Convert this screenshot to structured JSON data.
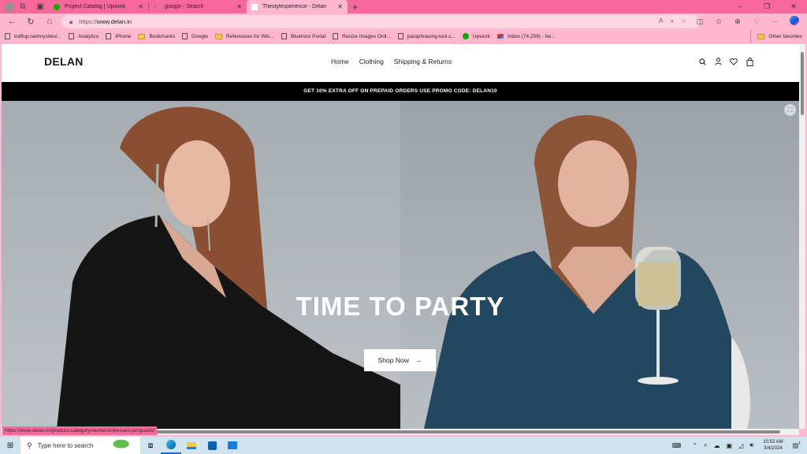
{
  "browser": {
    "tabs": [
      {
        "title": "Project Catalog | Upwork",
        "favicon": "upwork-icon",
        "active": false
      },
      {
        "title": "google - Search",
        "favicon": "search-icon",
        "active": false
      },
      {
        "title": "Thestylexperience - Delan",
        "favicon": "page-icon",
        "active": true
      }
    ],
    "new_tab": "+",
    "window_controls": {
      "minimize": "–",
      "restore": "❐",
      "close": "✕"
    },
    "address": {
      "scheme": "https://",
      "host": "www.delan.in"
    },
    "nav": {
      "back": "←",
      "refresh": "↻",
      "home": "⌂"
    },
    "favorites": [
      {
        "label": "traffup.net/mysites/...",
        "type": "page"
      },
      {
        "label": "Analytics",
        "type": "page"
      },
      {
        "label": "iPhone",
        "type": "page"
      },
      {
        "label": "Bookmarks",
        "type": "folder"
      },
      {
        "label": "Google",
        "type": "page"
      },
      {
        "label": "References for Win...",
        "type": "folder"
      },
      {
        "label": "Bluehost Portal",
        "type": "page"
      },
      {
        "label": "Resize Images Onli...",
        "type": "page"
      },
      {
        "label": "paraphrasing-tool.c...",
        "type": "page"
      },
      {
        "label": "Upwork",
        "type": "upwork"
      },
      {
        "label": "Inbox (74,259) - he...",
        "type": "gmail"
      }
    ],
    "other_favorites": "Other favorites",
    "status_url": "https://www.delan.in/product-category/womens/dresses-jumpsuits/"
  },
  "site": {
    "logo": "DELAN",
    "menu": [
      "Home",
      "Clothing",
      "Shipping & Returns"
    ],
    "promo": "GET 10% EXTRA OFF ON PREPAID ORDERS USE PROMO CODE: DELAN10",
    "hero": {
      "title": "TIME TO PARTY",
      "cta": "Shop Now",
      "cta_arrow": "→"
    }
  },
  "taskbar": {
    "search_placeholder": "Type here to search",
    "time": "10:53 AM",
    "date": "3/4/2024",
    "notification_count": "1"
  }
}
